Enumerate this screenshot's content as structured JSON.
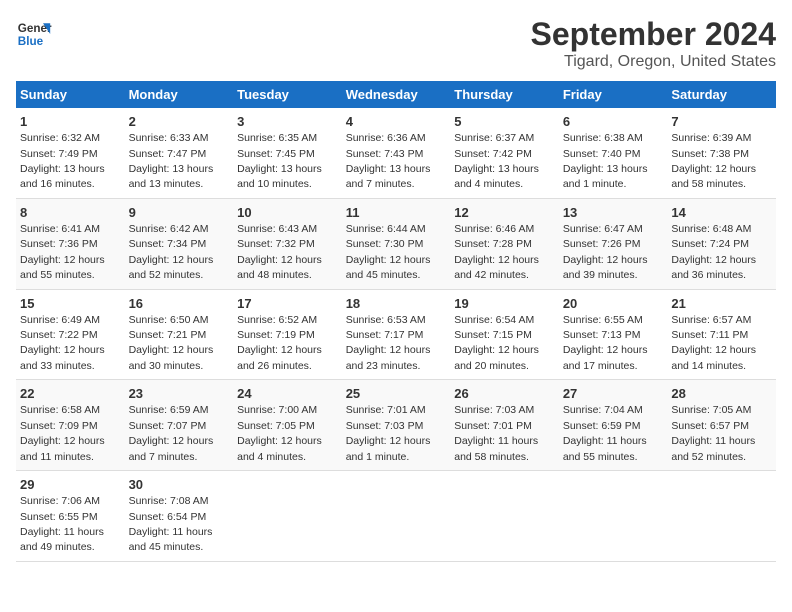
{
  "logo": {
    "line1": "General",
    "line2": "Blue"
  },
  "title": "September 2024",
  "subtitle": "Tigard, Oregon, United States",
  "days_of_week": [
    "Sunday",
    "Monday",
    "Tuesday",
    "Wednesday",
    "Thursday",
    "Friday",
    "Saturday"
  ],
  "weeks": [
    [
      {
        "num": "1",
        "rise": "6:32 AM",
        "set": "7:49 PM",
        "daylight": "13 hours and 16 minutes."
      },
      {
        "num": "2",
        "rise": "6:33 AM",
        "set": "7:47 PM",
        "daylight": "13 hours and 13 minutes."
      },
      {
        "num": "3",
        "rise": "6:35 AM",
        "set": "7:45 PM",
        "daylight": "13 hours and 10 minutes."
      },
      {
        "num": "4",
        "rise": "6:36 AM",
        "set": "7:43 PM",
        "daylight": "13 hours and 7 minutes."
      },
      {
        "num": "5",
        "rise": "6:37 AM",
        "set": "7:42 PM",
        "daylight": "13 hours and 4 minutes."
      },
      {
        "num": "6",
        "rise": "6:38 AM",
        "set": "7:40 PM",
        "daylight": "13 hours and 1 minute."
      },
      {
        "num": "7",
        "rise": "6:39 AM",
        "set": "7:38 PM",
        "daylight": "12 hours and 58 minutes."
      }
    ],
    [
      {
        "num": "8",
        "rise": "6:41 AM",
        "set": "7:36 PM",
        "daylight": "12 hours and 55 minutes."
      },
      {
        "num": "9",
        "rise": "6:42 AM",
        "set": "7:34 PM",
        "daylight": "12 hours and 52 minutes."
      },
      {
        "num": "10",
        "rise": "6:43 AM",
        "set": "7:32 PM",
        "daylight": "12 hours and 48 minutes."
      },
      {
        "num": "11",
        "rise": "6:44 AM",
        "set": "7:30 PM",
        "daylight": "12 hours and 45 minutes."
      },
      {
        "num": "12",
        "rise": "6:46 AM",
        "set": "7:28 PM",
        "daylight": "12 hours and 42 minutes."
      },
      {
        "num": "13",
        "rise": "6:47 AM",
        "set": "7:26 PM",
        "daylight": "12 hours and 39 minutes."
      },
      {
        "num": "14",
        "rise": "6:48 AM",
        "set": "7:24 PM",
        "daylight": "12 hours and 36 minutes."
      }
    ],
    [
      {
        "num": "15",
        "rise": "6:49 AM",
        "set": "7:22 PM",
        "daylight": "12 hours and 33 minutes."
      },
      {
        "num": "16",
        "rise": "6:50 AM",
        "set": "7:21 PM",
        "daylight": "12 hours and 30 minutes."
      },
      {
        "num": "17",
        "rise": "6:52 AM",
        "set": "7:19 PM",
        "daylight": "12 hours and 26 minutes."
      },
      {
        "num": "18",
        "rise": "6:53 AM",
        "set": "7:17 PM",
        "daylight": "12 hours and 23 minutes."
      },
      {
        "num": "19",
        "rise": "6:54 AM",
        "set": "7:15 PM",
        "daylight": "12 hours and 20 minutes."
      },
      {
        "num": "20",
        "rise": "6:55 AM",
        "set": "7:13 PM",
        "daylight": "12 hours and 17 minutes."
      },
      {
        "num": "21",
        "rise": "6:57 AM",
        "set": "7:11 PM",
        "daylight": "12 hours and 14 minutes."
      }
    ],
    [
      {
        "num": "22",
        "rise": "6:58 AM",
        "set": "7:09 PM",
        "daylight": "12 hours and 11 minutes."
      },
      {
        "num": "23",
        "rise": "6:59 AM",
        "set": "7:07 PM",
        "daylight": "12 hours and 7 minutes."
      },
      {
        "num": "24",
        "rise": "7:00 AM",
        "set": "7:05 PM",
        "daylight": "12 hours and 4 minutes."
      },
      {
        "num": "25",
        "rise": "7:01 AM",
        "set": "7:03 PM",
        "daylight": "12 hours and 1 minute."
      },
      {
        "num": "26",
        "rise": "7:03 AM",
        "set": "7:01 PM",
        "daylight": "11 hours and 58 minutes."
      },
      {
        "num": "27",
        "rise": "7:04 AM",
        "set": "6:59 PM",
        "daylight": "11 hours and 55 minutes."
      },
      {
        "num": "28",
        "rise": "7:05 AM",
        "set": "6:57 PM",
        "daylight": "11 hours and 52 minutes."
      }
    ],
    [
      {
        "num": "29",
        "rise": "7:06 AM",
        "set": "6:55 PM",
        "daylight": "11 hours and 49 minutes."
      },
      {
        "num": "30",
        "rise": "7:08 AM",
        "set": "6:54 PM",
        "daylight": "11 hours and 45 minutes."
      },
      {
        "num": "",
        "rise": "",
        "set": "",
        "daylight": ""
      },
      {
        "num": "",
        "rise": "",
        "set": "",
        "daylight": ""
      },
      {
        "num": "",
        "rise": "",
        "set": "",
        "daylight": ""
      },
      {
        "num": "",
        "rise": "",
        "set": "",
        "daylight": ""
      },
      {
        "num": "",
        "rise": "",
        "set": "",
        "daylight": ""
      }
    ]
  ]
}
